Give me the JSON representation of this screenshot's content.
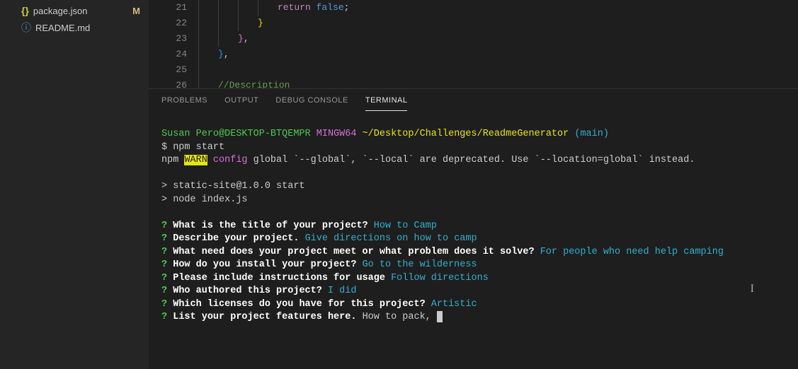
{
  "sidebar": {
    "files": [
      {
        "name": "package.json",
        "status": "M",
        "iconType": "json"
      },
      {
        "name": "README.md",
        "status": "",
        "iconType": "info"
      }
    ]
  },
  "editor": {
    "lines": [
      {
        "num": "21",
        "indent": 3,
        "tokens": [
          {
            "cls": "kw-return",
            "t": "return"
          },
          {
            "cls": "",
            "t": " "
          },
          {
            "cls": "kw-false",
            "t": "false"
          },
          {
            "cls": "kw-semi",
            "t": ";"
          }
        ]
      },
      {
        "num": "22",
        "indent": 2,
        "tokens": [
          {
            "cls": "kw-brace",
            "t": "}"
          }
        ]
      },
      {
        "num": "23",
        "indent": 1,
        "tokens": [
          {
            "cls": "kw-brace2",
            "t": "}"
          },
          {
            "cls": "kw-comma",
            "t": ","
          }
        ]
      },
      {
        "num": "24",
        "indent": 0,
        "tokens": [
          {
            "cls": "kw-brace3",
            "t": "}"
          },
          {
            "cls": "kw-comma",
            "t": ","
          }
        ]
      },
      {
        "num": "25",
        "indent": 0,
        "tokens": []
      },
      {
        "num": "26",
        "indent": 0,
        "tokens": [
          {
            "cls": "kw-comment",
            "t": "//Description"
          }
        ]
      }
    ]
  },
  "panel": {
    "tabs": {
      "problems": "PROBLEMS",
      "output": "OUTPUT",
      "debug": "DEBUG CONSOLE",
      "terminal": "TERMINAL"
    }
  },
  "terminal": {
    "user": "Susan Pero@DESKTOP-BTQEMPR",
    "sys": "MINGW64",
    "path": "~/Desktop/Challenges/ReadmeGenerator",
    "branch": "(main)",
    "cmdPrompt": "$ ",
    "cmd": "npm start",
    "warnPrefix": "npm ",
    "warnTag": "WARN",
    "warnCfg": " config",
    "warnMsg": " global `--global`, `--local` are deprecated. Use `--location=global` instead.",
    "script1": "> static-site@1.0.0 start",
    "script2": "> node index.js",
    "qa": [
      {
        "q": "What is the title of your project? ",
        "a": "How to Camp"
      },
      {
        "q": "Describe your project. ",
        "a": "Give directions on how to camp"
      },
      {
        "q": "What need does your project meet or what problem does it solve? ",
        "a": "For people who need help camping"
      },
      {
        "q": "How do you install your project? ",
        "a": "Go to the wilderness"
      },
      {
        "q": "Please include instructions for usage ",
        "a": "Follow directions"
      },
      {
        "q": "Who authored this project? ",
        "a": "I did"
      },
      {
        "q": "Which licenses do you have for this project? ",
        "a": "Artistic"
      }
    ],
    "currentQ": "List your project features here. ",
    "currentInput": "How to pack, ",
    "qMark": "?"
  }
}
